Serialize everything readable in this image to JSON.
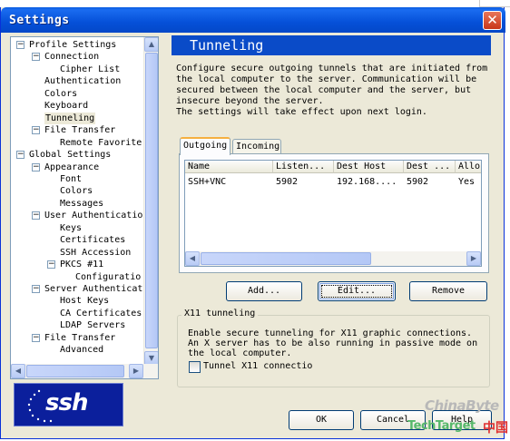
{
  "window": {
    "title": "Settings",
    "close_glyph": "✕"
  },
  "tree": {
    "items": [
      {
        "label": "Profile Settings",
        "expander": "−"
      },
      {
        "label": "Connection",
        "expander": "−"
      },
      {
        "label": "Cipher List",
        "expander": ""
      },
      {
        "label": "Authentication",
        "expander": ""
      },
      {
        "label": "Colors",
        "expander": ""
      },
      {
        "label": "Keyboard",
        "expander": ""
      },
      {
        "label": "Tunneling",
        "expander": ""
      },
      {
        "label": "File Transfer",
        "expander": "−"
      },
      {
        "label": "Remote Favorite",
        "expander": ""
      },
      {
        "label": "Global Settings",
        "expander": "−"
      },
      {
        "label": "Appearance",
        "expander": "−"
      },
      {
        "label": "Font",
        "expander": ""
      },
      {
        "label": "Colors",
        "expander": ""
      },
      {
        "label": "Messages",
        "expander": ""
      },
      {
        "label": "User Authenticatio",
        "expander": "−"
      },
      {
        "label": "Keys",
        "expander": ""
      },
      {
        "label": "Certificates",
        "expander": ""
      },
      {
        "label": "SSH Accession",
        "expander": ""
      },
      {
        "label": "PKCS #11",
        "expander": "−"
      },
      {
        "label": "Configuratio",
        "expander": ""
      },
      {
        "label": "Server Authenticat",
        "expander": "−"
      },
      {
        "label": "Host Keys",
        "expander": ""
      },
      {
        "label": "CA Certificates",
        "expander": ""
      },
      {
        "label": "LDAP Servers",
        "expander": ""
      },
      {
        "label": "File Transfer",
        "expander": "−"
      },
      {
        "label": "Advanced",
        "expander": ""
      }
    ],
    "selected": "Tunneling",
    "scroll_up": "▲",
    "scroll_down": "▼",
    "scroll_left": "◀",
    "scroll_right": "▶"
  },
  "logo": {
    "text": "ssh"
  },
  "panel": {
    "heading": "Tunneling",
    "description": "Configure secure outgoing tunnels that are initiated from the local computer to the server. Communication will be secured between the local computer and the server, but insecure beyond the server.\nThe settings will take effect upon next login."
  },
  "tabs": [
    {
      "label": "Outgoing",
      "active": true
    },
    {
      "label": "Incoming",
      "active": false
    }
  ],
  "table": {
    "columns": [
      "Name",
      "Listen...",
      "Dest Host",
      "Dest ...",
      "Allo"
    ],
    "rows": [
      [
        "SSH+VNC",
        "5902",
        "192.168....",
        "5902",
        "Yes"
      ]
    ],
    "scroll_left": "◀",
    "scroll_right": "▶"
  },
  "buttons": {
    "add": "Add...",
    "edit": "Edit...",
    "remove": "Remove"
  },
  "x11": {
    "title": "X11 tunneling",
    "description": "Enable secure tunneling for X11 graphic connections. An X server has to be also running in passive mode on the local computer.",
    "checkbox_label": "Tunnel X11 connectio",
    "checked": false
  },
  "footer": {
    "ok": "OK",
    "cancel": "Cancel",
    "help": "Help"
  },
  "watermark": {
    "line1": "ChinaByte",
    "line2": "TechTarget",
    "line3": "中国"
  }
}
